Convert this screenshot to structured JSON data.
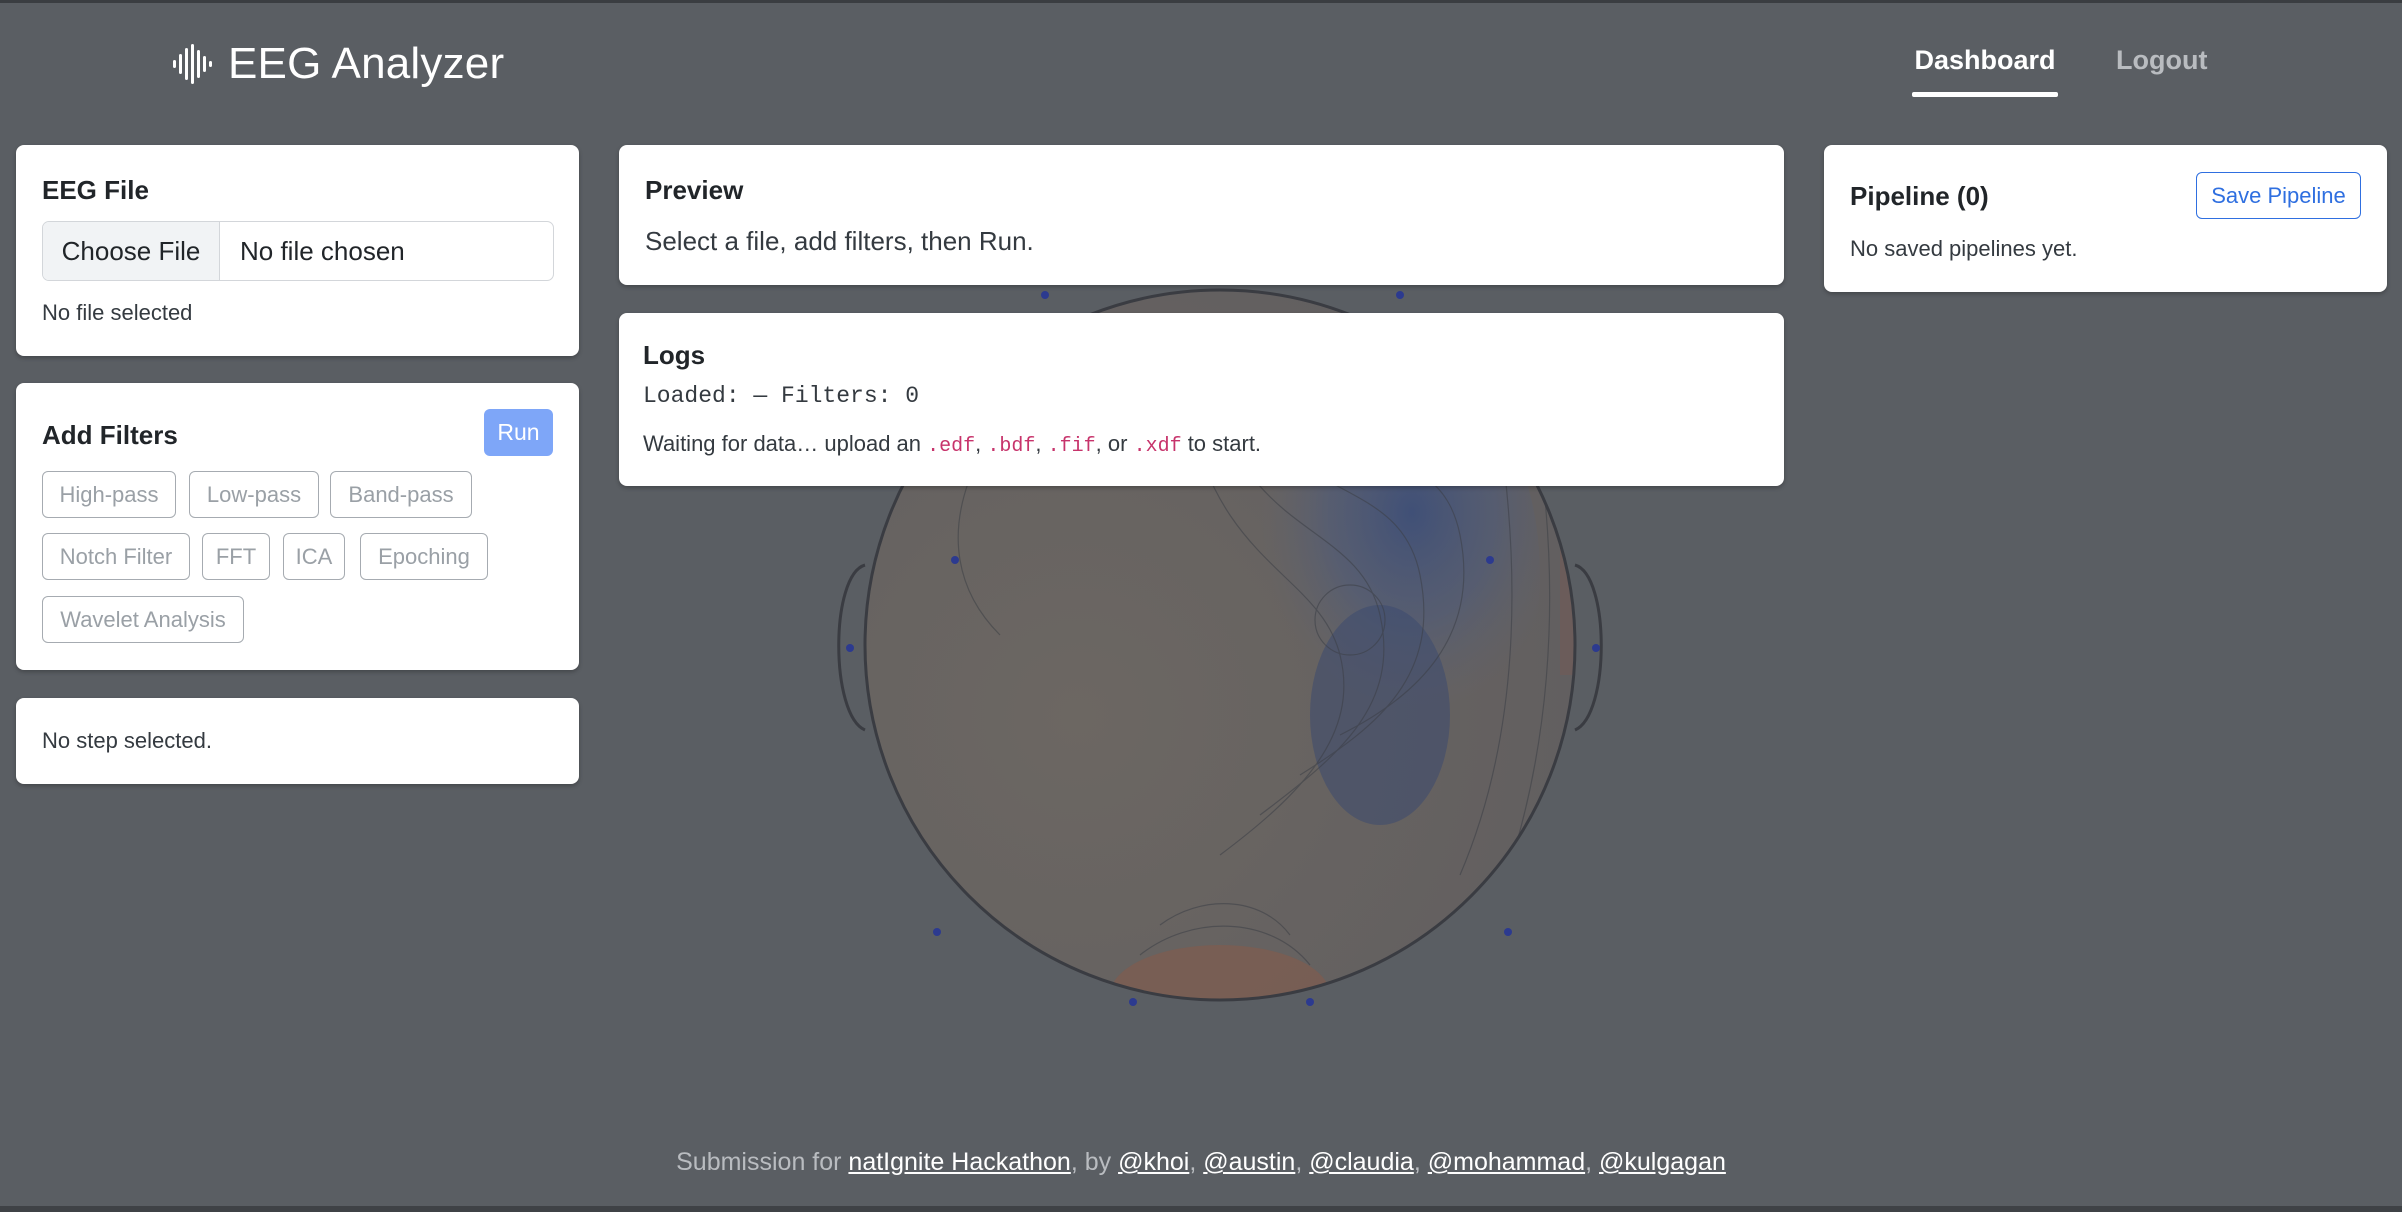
{
  "header": {
    "app_title": "EEG Analyzer",
    "logo_icon": "waveform-icon",
    "nav": {
      "dashboard": "Dashboard",
      "logout": "Logout",
      "active": "Dashboard"
    }
  },
  "eeg_file": {
    "title": "EEG File",
    "choose_label": "Choose File",
    "chosen_text": "No file chosen",
    "status": "No file selected"
  },
  "filters": {
    "title": "Add Filters",
    "run_label": "Run",
    "chips": [
      "High-pass",
      "Low-pass",
      "Band-pass",
      "Notch Filter",
      "FFT",
      "ICA",
      "Epoching",
      "Wavelet Analysis"
    ]
  },
  "step": {
    "status": "No step selected."
  },
  "preview": {
    "title": "Preview",
    "text": "Select a file, add filters, then Run."
  },
  "logs": {
    "title": "Logs",
    "loaded_line": "Loaded: — Filters: 0",
    "waiting_prefix": "Waiting for data… upload an ",
    "ext_edf": ".edf",
    "sep1": ", ",
    "ext_bdf": ".bdf",
    "sep2": ", ",
    "ext_fif": ".fif",
    "sep3": ", or ",
    "ext_xdf": ".xdf",
    "waiting_suffix": " to start."
  },
  "pipeline": {
    "title": "Pipeline (0)",
    "save_label": "Save Pipeline",
    "empty_text": "No saved pipelines yet."
  },
  "footer": {
    "prefix": "Submission for ",
    "hackathon": "natIgnite Hackathon",
    "by": ", by ",
    "authors": [
      "@khoi",
      "@austin",
      "@claudia",
      "@mohammad",
      "@kulgagan"
    ],
    "separator": ", "
  },
  "colors": {
    "background": "#5a5e63",
    "card": "#ffffff",
    "run_button": "#7ea6f8",
    "save_button": "#2f6fe0",
    "code": "#c7336b"
  }
}
